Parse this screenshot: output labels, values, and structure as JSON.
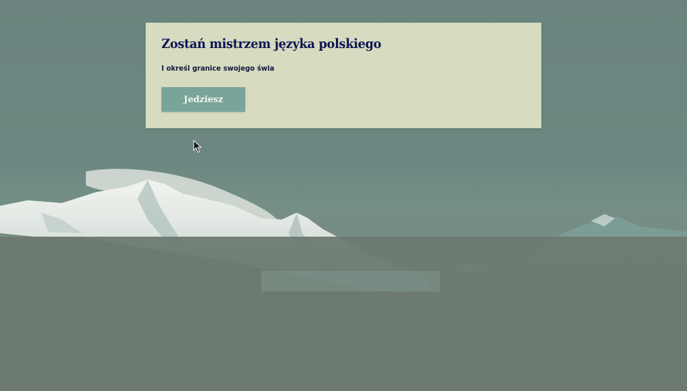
{
  "card": {
    "title": "Zostań mistrzem języka polskiego",
    "subtitle": "I określ granice swojego świa",
    "button_label": "Jedziesz"
  },
  "colors": {
    "card_background": "#d7dbbf",
    "title_color": "#0c1454",
    "button_background": "#79a49a",
    "button_text": "#f2f4ec",
    "page_background": "#6f8680"
  },
  "icons": {
    "pointer": "mouse-pointer-icon"
  }
}
